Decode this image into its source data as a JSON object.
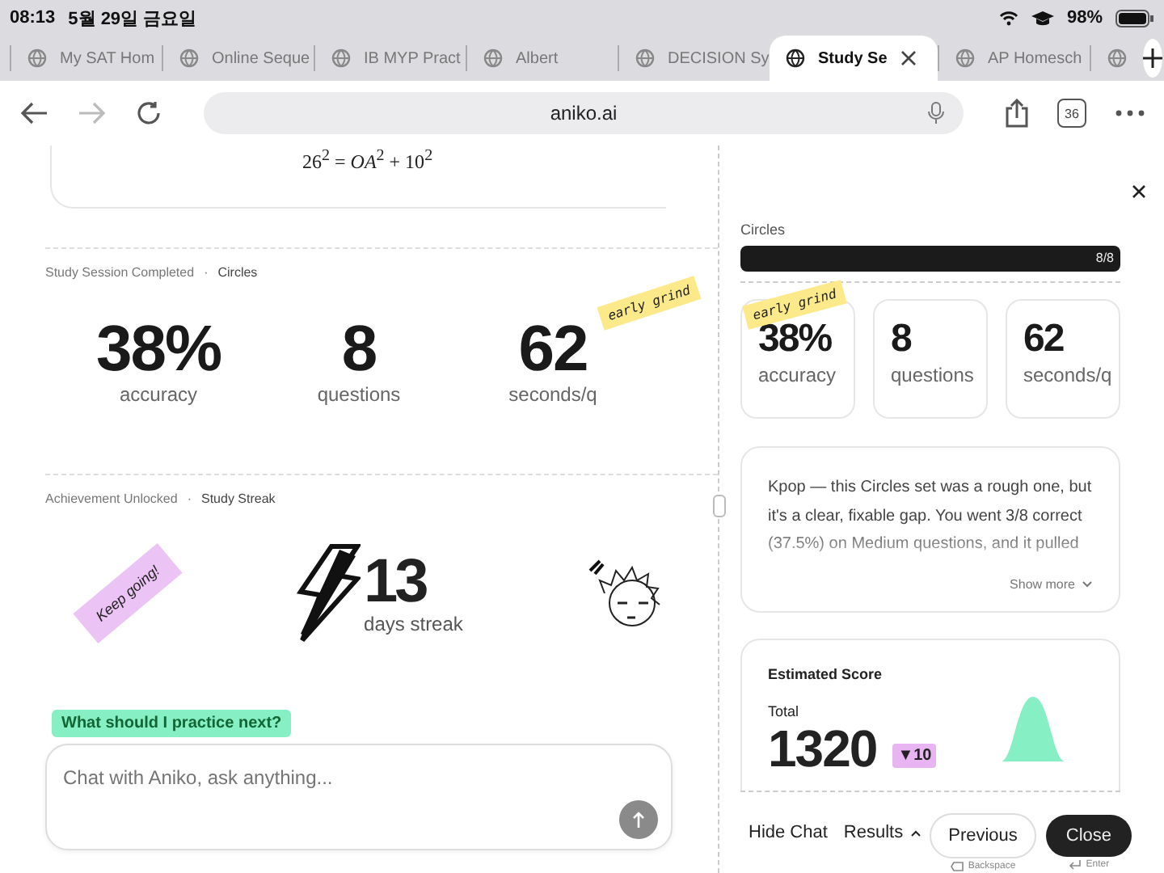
{
  "status_bar": {
    "time": "08:13",
    "date": "5월 29일 금요일",
    "battery": "98%"
  },
  "tabs": [
    {
      "label": "My SAT Hom",
      "selected": false
    },
    {
      "label": "Online Seque",
      "selected": false
    },
    {
      "label": "IB MYP Pract",
      "selected": false
    },
    {
      "label": "Albert",
      "selected": false
    },
    {
      "label": "DECISION Sy",
      "selected": false
    },
    {
      "label": "Study Se",
      "selected": true
    },
    {
      "label": "AP Homesch",
      "selected": false
    },
    {
      "selected": false
    }
  ],
  "toolbar": {
    "url": "aniko.ai",
    "tab_count": "36"
  },
  "left": {
    "equation": "26$^{2}$ = *OA*$^{2}$ + 10$^{2}$",
    "session": {
      "label": "Study Session Completed",
      "separator": "·",
      "topic": "Circles",
      "sticker": "early grind",
      "stats": [
        {
          "value": "38%",
          "label": "accuracy"
        },
        {
          "value": "8",
          "label": "questions"
        },
        {
          "value": "62",
          "label": "seconds/q"
        }
      ]
    },
    "achievement": {
      "label": "Achievement Unlocked",
      "separator": "·",
      "topic": "Study Streak",
      "sticker": "Keep going!",
      "value": "13",
      "caption": "days streak"
    },
    "suggestion": "What should I practice next?",
    "chat": {
      "placeholder": "Chat with Aniko, ask anything..."
    }
  },
  "right": {
    "topic": "Circles",
    "progress": {
      "level": 1,
      "reading": "8/8"
    },
    "sticker": "early grind",
    "stats": [
      {
        "value": "38%",
        "label": "accuracy"
      },
      {
        "value": "8",
        "label": "questions"
      },
      {
        "value": "62",
        "label": "seconds/q"
      }
    ],
    "summary": "Kpop — this Circles set was a rough one, but it's a clear, fixable gap. You went 3/8 correct (37.5%) on Medium questions, and it pulled",
    "show_more": "Show more",
    "score": {
      "title": "Estimated Score",
      "total_label": "Total",
      "total": "1320",
      "change": "▼10"
    },
    "bottom_bar": {
      "hide_chat": "Hide Chat",
      "results": "Results",
      "previous": "Previous",
      "previous_hint": "Backspace",
      "close": "Close",
      "close_hint": "Enter"
    }
  }
}
